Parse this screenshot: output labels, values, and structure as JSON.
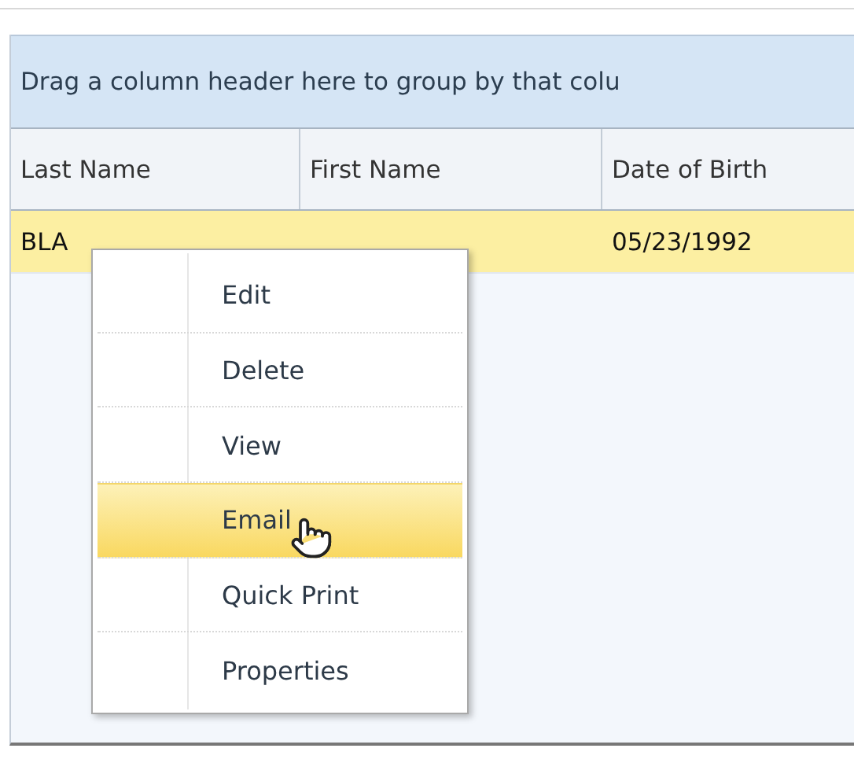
{
  "group_panel": {
    "text": "Drag a column header here to group by that colu"
  },
  "table": {
    "columns": [
      "Last Name",
      "First Name",
      "Date of Birth"
    ],
    "rows": [
      {
        "selected": true,
        "cells": [
          "BLA",
          "",
          "05/23/1992"
        ]
      }
    ]
  },
  "context_menu": {
    "items": [
      {
        "label": "Edit",
        "selected": false
      },
      {
        "label": "Delete",
        "selected": false
      },
      {
        "label": "View",
        "selected": false
      },
      {
        "label": "Email",
        "selected": true
      },
      {
        "label": "Quick Print",
        "selected": false
      },
      {
        "label": "Properties",
        "selected": false
      }
    ]
  }
}
